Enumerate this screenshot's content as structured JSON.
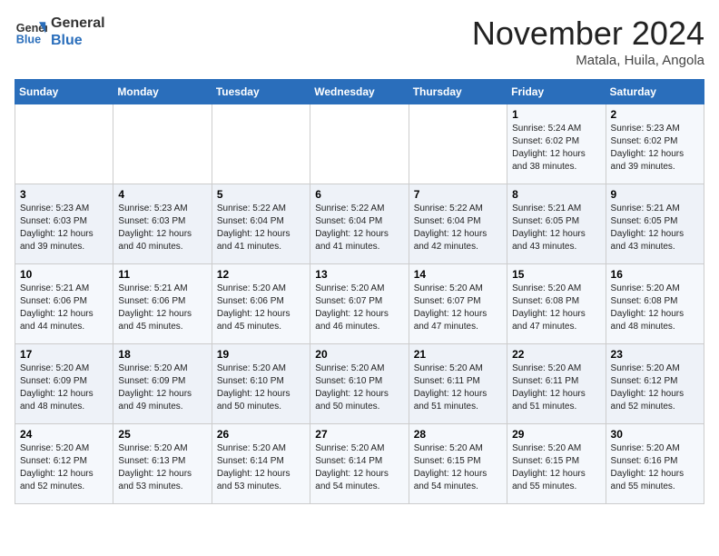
{
  "header": {
    "logo_line1": "General",
    "logo_line2": "Blue",
    "month": "November 2024",
    "location": "Matala, Huila, Angola"
  },
  "weekdays": [
    "Sunday",
    "Monday",
    "Tuesday",
    "Wednesday",
    "Thursday",
    "Friday",
    "Saturday"
  ],
  "rows": [
    [
      {
        "day": "",
        "sunrise": "",
        "sunset": "",
        "daylight": ""
      },
      {
        "day": "",
        "sunrise": "",
        "sunset": "",
        "daylight": ""
      },
      {
        "day": "",
        "sunrise": "",
        "sunset": "",
        "daylight": ""
      },
      {
        "day": "",
        "sunrise": "",
        "sunset": "",
        "daylight": ""
      },
      {
        "day": "",
        "sunrise": "",
        "sunset": "",
        "daylight": ""
      },
      {
        "day": "1",
        "sunrise": "Sunrise: 5:24 AM",
        "sunset": "Sunset: 6:02 PM",
        "daylight": "Daylight: 12 hours and 38 minutes."
      },
      {
        "day": "2",
        "sunrise": "Sunrise: 5:23 AM",
        "sunset": "Sunset: 6:02 PM",
        "daylight": "Daylight: 12 hours and 39 minutes."
      }
    ],
    [
      {
        "day": "3",
        "sunrise": "Sunrise: 5:23 AM",
        "sunset": "Sunset: 6:03 PM",
        "daylight": "Daylight: 12 hours and 39 minutes."
      },
      {
        "day": "4",
        "sunrise": "Sunrise: 5:23 AM",
        "sunset": "Sunset: 6:03 PM",
        "daylight": "Daylight: 12 hours and 40 minutes."
      },
      {
        "day": "5",
        "sunrise": "Sunrise: 5:22 AM",
        "sunset": "Sunset: 6:04 PM",
        "daylight": "Daylight: 12 hours and 41 minutes."
      },
      {
        "day": "6",
        "sunrise": "Sunrise: 5:22 AM",
        "sunset": "Sunset: 6:04 PM",
        "daylight": "Daylight: 12 hours and 41 minutes."
      },
      {
        "day": "7",
        "sunrise": "Sunrise: 5:22 AM",
        "sunset": "Sunset: 6:04 PM",
        "daylight": "Daylight: 12 hours and 42 minutes."
      },
      {
        "day": "8",
        "sunrise": "Sunrise: 5:21 AM",
        "sunset": "Sunset: 6:05 PM",
        "daylight": "Daylight: 12 hours and 43 minutes."
      },
      {
        "day": "9",
        "sunrise": "Sunrise: 5:21 AM",
        "sunset": "Sunset: 6:05 PM",
        "daylight": "Daylight: 12 hours and 43 minutes."
      }
    ],
    [
      {
        "day": "10",
        "sunrise": "Sunrise: 5:21 AM",
        "sunset": "Sunset: 6:06 PM",
        "daylight": "Daylight: 12 hours and 44 minutes."
      },
      {
        "day": "11",
        "sunrise": "Sunrise: 5:21 AM",
        "sunset": "Sunset: 6:06 PM",
        "daylight": "Daylight: 12 hours and 45 minutes."
      },
      {
        "day": "12",
        "sunrise": "Sunrise: 5:20 AM",
        "sunset": "Sunset: 6:06 PM",
        "daylight": "Daylight: 12 hours and 45 minutes."
      },
      {
        "day": "13",
        "sunrise": "Sunrise: 5:20 AM",
        "sunset": "Sunset: 6:07 PM",
        "daylight": "Daylight: 12 hours and 46 minutes."
      },
      {
        "day": "14",
        "sunrise": "Sunrise: 5:20 AM",
        "sunset": "Sunset: 6:07 PM",
        "daylight": "Daylight: 12 hours and 47 minutes."
      },
      {
        "day": "15",
        "sunrise": "Sunrise: 5:20 AM",
        "sunset": "Sunset: 6:08 PM",
        "daylight": "Daylight: 12 hours and 47 minutes."
      },
      {
        "day": "16",
        "sunrise": "Sunrise: 5:20 AM",
        "sunset": "Sunset: 6:08 PM",
        "daylight": "Daylight: 12 hours and 48 minutes."
      }
    ],
    [
      {
        "day": "17",
        "sunrise": "Sunrise: 5:20 AM",
        "sunset": "Sunset: 6:09 PM",
        "daylight": "Daylight: 12 hours and 48 minutes."
      },
      {
        "day": "18",
        "sunrise": "Sunrise: 5:20 AM",
        "sunset": "Sunset: 6:09 PM",
        "daylight": "Daylight: 12 hours and 49 minutes."
      },
      {
        "day": "19",
        "sunrise": "Sunrise: 5:20 AM",
        "sunset": "Sunset: 6:10 PM",
        "daylight": "Daylight: 12 hours and 50 minutes."
      },
      {
        "day": "20",
        "sunrise": "Sunrise: 5:20 AM",
        "sunset": "Sunset: 6:10 PM",
        "daylight": "Daylight: 12 hours and 50 minutes."
      },
      {
        "day": "21",
        "sunrise": "Sunrise: 5:20 AM",
        "sunset": "Sunset: 6:11 PM",
        "daylight": "Daylight: 12 hours and 51 minutes."
      },
      {
        "day": "22",
        "sunrise": "Sunrise: 5:20 AM",
        "sunset": "Sunset: 6:11 PM",
        "daylight": "Daylight: 12 hours and 51 minutes."
      },
      {
        "day": "23",
        "sunrise": "Sunrise: 5:20 AM",
        "sunset": "Sunset: 6:12 PM",
        "daylight": "Daylight: 12 hours and 52 minutes."
      }
    ],
    [
      {
        "day": "24",
        "sunrise": "Sunrise: 5:20 AM",
        "sunset": "Sunset: 6:12 PM",
        "daylight": "Daylight: 12 hours and 52 minutes."
      },
      {
        "day": "25",
        "sunrise": "Sunrise: 5:20 AM",
        "sunset": "Sunset: 6:13 PM",
        "daylight": "Daylight: 12 hours and 53 minutes."
      },
      {
        "day": "26",
        "sunrise": "Sunrise: 5:20 AM",
        "sunset": "Sunset: 6:14 PM",
        "daylight": "Daylight: 12 hours and 53 minutes."
      },
      {
        "day": "27",
        "sunrise": "Sunrise: 5:20 AM",
        "sunset": "Sunset: 6:14 PM",
        "daylight": "Daylight: 12 hours and 54 minutes."
      },
      {
        "day": "28",
        "sunrise": "Sunrise: 5:20 AM",
        "sunset": "Sunset: 6:15 PM",
        "daylight": "Daylight: 12 hours and 54 minutes."
      },
      {
        "day": "29",
        "sunrise": "Sunrise: 5:20 AM",
        "sunset": "Sunset: 6:15 PM",
        "daylight": "Daylight: 12 hours and 55 minutes."
      },
      {
        "day": "30",
        "sunrise": "Sunrise: 5:20 AM",
        "sunset": "Sunset: 6:16 PM",
        "daylight": "Daylight: 12 hours and 55 minutes."
      }
    ]
  ]
}
